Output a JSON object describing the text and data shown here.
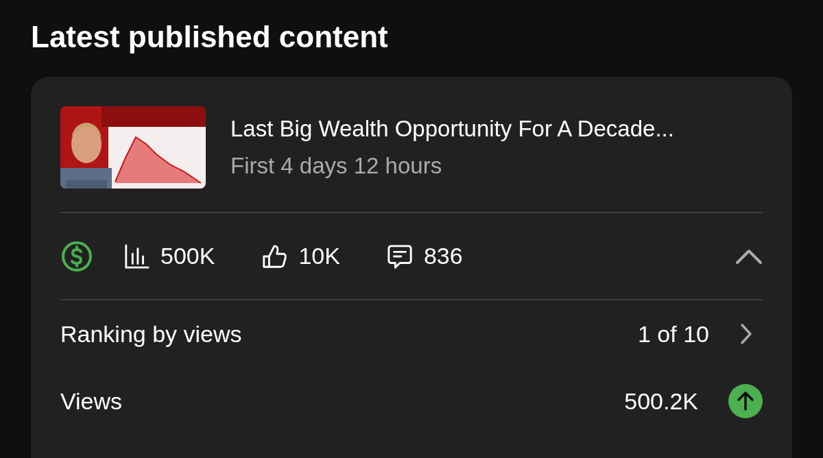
{
  "heading": "Latest published content",
  "video": {
    "title": "Last Big Wealth Opportunity For A Decade...",
    "period": "First 4 days 12 hours"
  },
  "stats": {
    "monetized": true,
    "expanded": true,
    "metrics": [
      {
        "kind": "views",
        "value": "500K"
      },
      {
        "kind": "likes",
        "value": "10K"
      },
      {
        "kind": "comments",
        "value": "836"
      }
    ]
  },
  "rows": [
    {
      "kind": "link",
      "label": "Ranking by views",
      "value": "1 of 10"
    },
    {
      "kind": "trend",
      "label": "Views",
      "value": "500.2K",
      "rising": true
    }
  ]
}
